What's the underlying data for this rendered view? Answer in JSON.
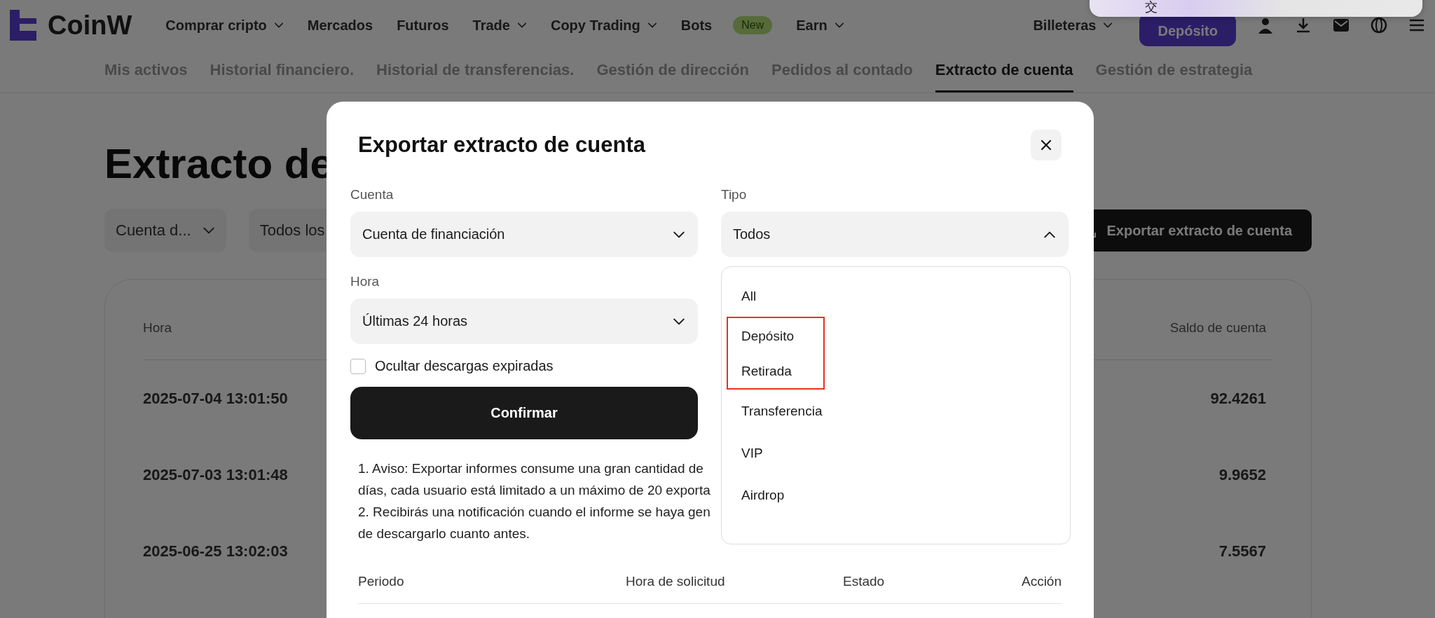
{
  "header": {
    "logo": "CoinW",
    "nav": [
      {
        "label": "Comprar cripto",
        "caret": true
      },
      {
        "label": "Mercados",
        "caret": false
      },
      {
        "label": "Futuros",
        "caret": false
      },
      {
        "label": "Trade",
        "caret": true
      },
      {
        "label": "Copy Trading",
        "caret": true
      },
      {
        "label": "Bots",
        "caret": false,
        "badge": "New"
      },
      {
        "label": "Earn",
        "caret": true
      }
    ],
    "wallet": "Billeteras",
    "deposit_button": "Depósito"
  },
  "subnav": [
    {
      "label": "Mis activos",
      "selected": false
    },
    {
      "label": "Historial financiero.",
      "selected": false
    },
    {
      "label": "Historial de transferencias.",
      "selected": false
    },
    {
      "label": "Gestión de dirección",
      "selected": false
    },
    {
      "label": "Pedidos al contado",
      "selected": false
    },
    {
      "label": "Extracto de cuenta",
      "selected": true
    },
    {
      "label": "Gestión de estrategia",
      "selected": false
    }
  ],
  "page": {
    "title": "Extracto de",
    "filters": [
      {
        "label": "Cuenta d...",
        "caret": true
      },
      {
        "label": "Todos los",
        "caret": false
      }
    ],
    "export_button": "Exportar extracto de cuenta",
    "table": {
      "columns": [
        "Hora",
        "Saldo de cuenta"
      ],
      "rows": [
        {
          "time": "2025-07-04 13:01:50",
          "balance": "92.4261"
        },
        {
          "time": "2025-07-03 13:01:48",
          "balance": "9.9652"
        },
        {
          "time": "2025-06-25 13:02:03",
          "balance": "7.5567"
        }
      ]
    }
  },
  "modal": {
    "title": "Exportar extracto de cuenta",
    "fields": [
      {
        "label": "Cuenta",
        "value": "Cuenta de financiación",
        "expanded": false
      },
      {
        "label": "Tipo",
        "value": "Todos",
        "expanded": true,
        "options": [
          {
            "label": "All",
            "highlighted": false
          },
          {
            "label": "Depósito",
            "highlighted": true
          },
          {
            "label": "Retirada",
            "highlighted": true
          },
          {
            "label": "Transferencia",
            "highlighted": false
          },
          {
            "label": "VIP",
            "highlighted": false
          },
          {
            "label": "Airdrop",
            "highlighted": false
          }
        ]
      },
      {
        "label": "Hora",
        "value": "Últimas 24 horas",
        "expanded": false
      }
    ],
    "checkbox": {
      "label": "Ocultar descargas expiradas",
      "checked": false
    },
    "confirm_button": "Confirmar",
    "notice_lines": [
      "1. Aviso: Exportar informes consume una gran cantidad de",
      "días, cada usuario está limitado a un máximo de 20 exporta",
      "2. Recibirás una notificación cuando el informe se haya gen",
      "de descargarlo cuanto antes."
    ],
    "columns": [
      "Periodo",
      "Hora de solicitud",
      "Estado",
      "Acción"
    ]
  },
  "system_popup": {
    "text": "交"
  }
}
